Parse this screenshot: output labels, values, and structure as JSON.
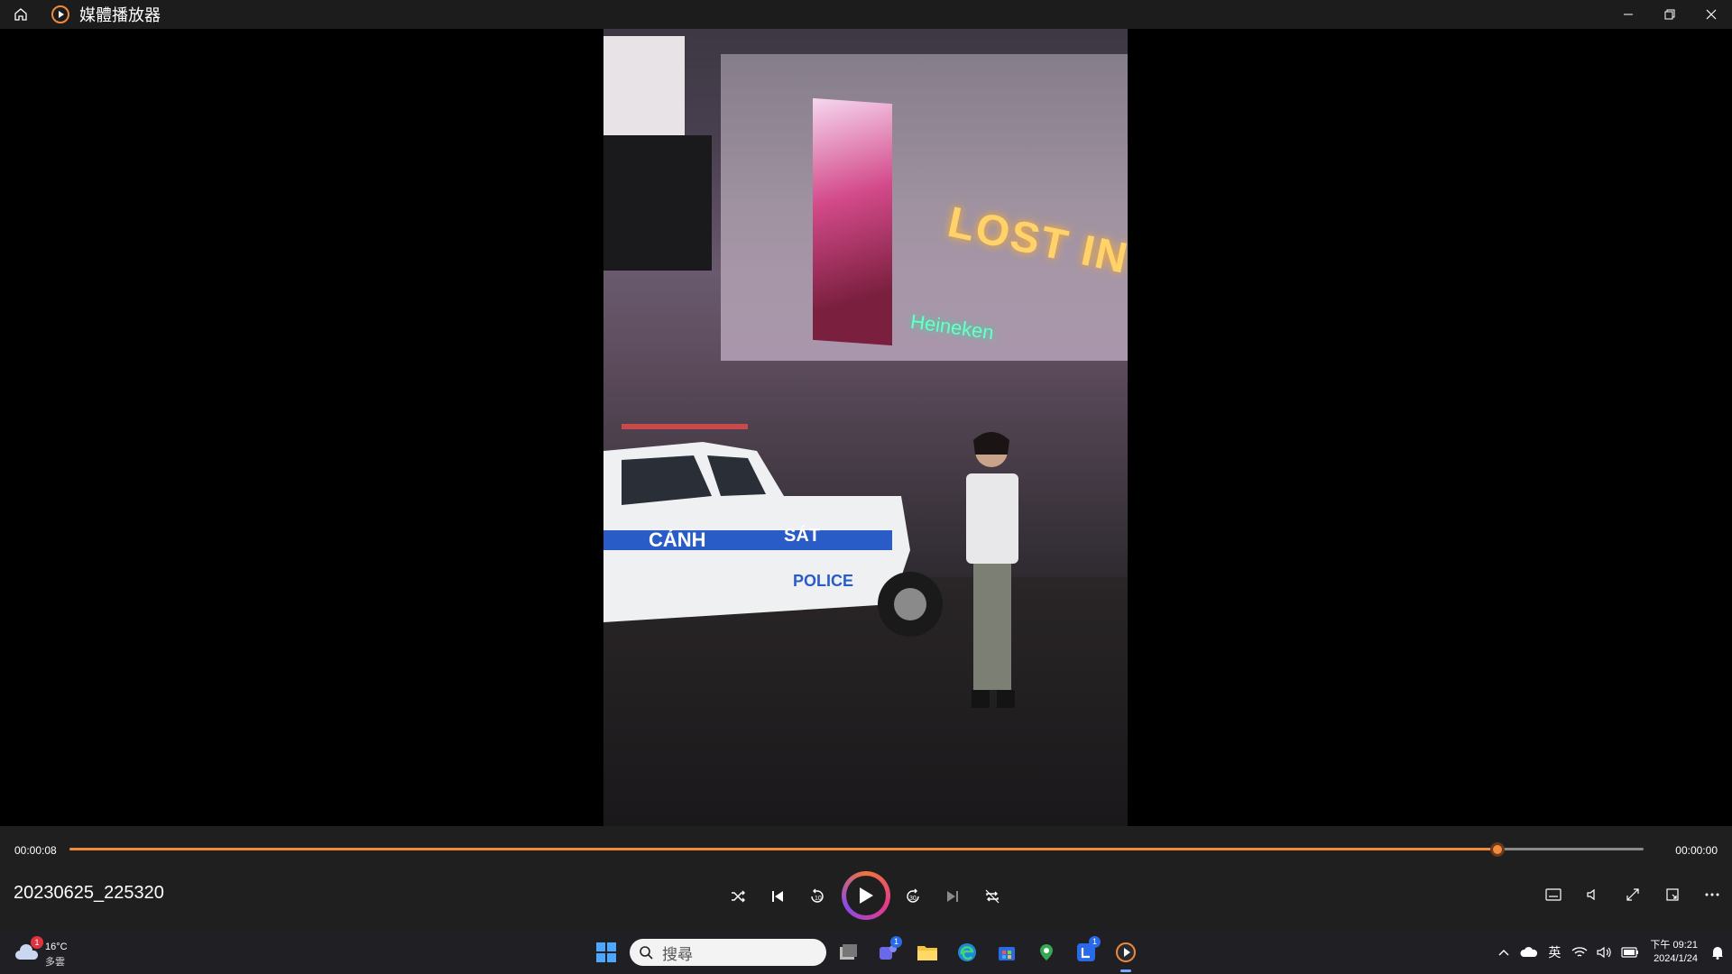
{
  "titlebar": {
    "title": "媒體播放器",
    "home_icon": "home-icon",
    "app_icon": "media-player-icon",
    "controls": [
      "minimize-icon",
      "restore-icon",
      "close-icon"
    ]
  },
  "video": {
    "sign_text": "LOST IN SAIGON",
    "car_text": [
      "CẢNH",
      "SÁT",
      "POLICE"
    ],
    "heineken": "Heineken"
  },
  "player": {
    "current_time": "00:00:08",
    "total_time": "00:00:00",
    "progress": 0.907,
    "file_name": "20230625_225320",
    "accent": "#f08a3c",
    "center_buttons": [
      "shuffle-icon",
      "previous-icon",
      "rewind-10-icon",
      "play-icon",
      "forward-30-icon",
      "next-icon",
      "repeat-icon"
    ],
    "right_buttons": [
      "subtitles-icon",
      "volume-icon",
      "fullscreen-icon",
      "miniplayer-icon",
      "more-icon"
    ]
  },
  "taskbar": {
    "weather_temp": "16°C",
    "weather_desc": "多雲",
    "weather_badge": "1",
    "search_placeholder": "搜尋",
    "apps": [
      {
        "name": "task-view-icon"
      },
      {
        "name": "teams-icon",
        "badge": "1"
      },
      {
        "name": "file-explorer-icon"
      },
      {
        "name": "edge-icon"
      },
      {
        "name": "store-icon"
      },
      {
        "name": "maps-icon"
      },
      {
        "name": "line-icon",
        "badge": "1"
      },
      {
        "name": "media-player-icon",
        "active": true
      }
    ],
    "tray": {
      "ime": "英",
      "time": "下午 09:21",
      "date": "2024/1/24"
    }
  }
}
